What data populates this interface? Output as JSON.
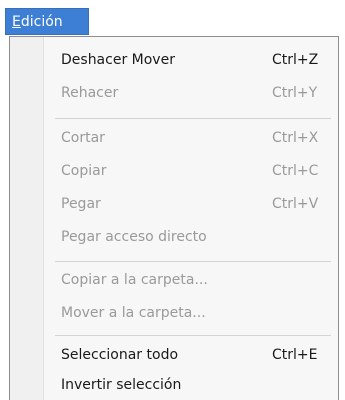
{
  "menubar": {
    "active_menu_first": "E",
    "active_menu_rest": "dición"
  },
  "menu": {
    "items": [
      {
        "label": "Deshacer Mover",
        "shortcut": "Ctrl+Z",
        "enabled": true
      },
      {
        "label": "Rehacer",
        "shortcut": "Ctrl+Y",
        "enabled": false
      },
      {
        "label": "Cortar",
        "shortcut": "Ctrl+X",
        "enabled": false
      },
      {
        "label": "Copiar",
        "shortcut": "Ctrl+C",
        "enabled": false
      },
      {
        "label": "Pegar",
        "shortcut": "Ctrl+V",
        "enabled": false
      },
      {
        "label": "Pegar acceso directo",
        "shortcut": "",
        "enabled": false
      },
      {
        "label": "Copiar a la carpeta...",
        "shortcut": "",
        "enabled": false
      },
      {
        "label": "Mover a la carpeta...",
        "shortcut": "",
        "enabled": false
      },
      {
        "label": "Seleccionar todo",
        "shortcut": "Ctrl+E",
        "enabled": true
      },
      {
        "label": "Invertir selección",
        "shortcut": "",
        "enabled": true
      }
    ]
  },
  "colors": {
    "menubar_highlight": "#3c7fd4",
    "enabled_text": "#1a1a1a",
    "disabled_text": "#9a9a9a"
  }
}
